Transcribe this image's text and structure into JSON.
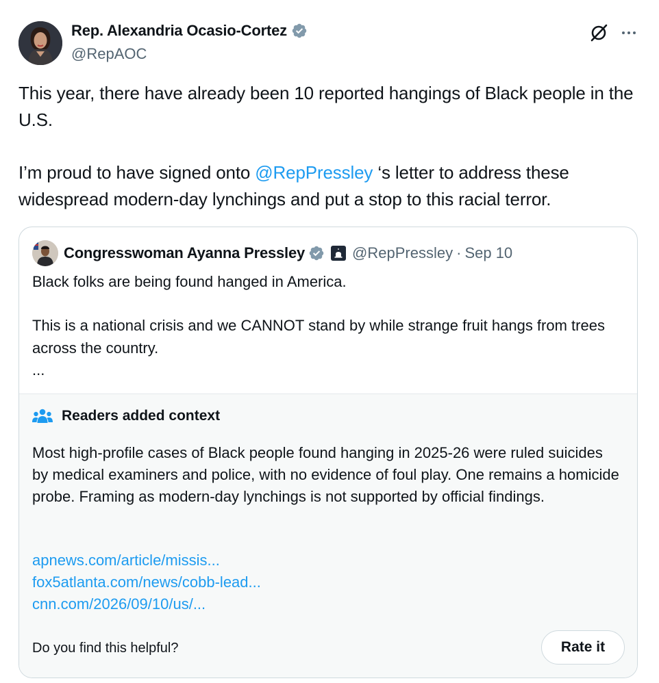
{
  "author": {
    "display_name": "Rep. Alexandria Ocasio-Cortez",
    "handle": "@RepAOC",
    "verified_icon": "verified-badge-gray"
  },
  "tweet": {
    "line1": "This year, there have already been 10 reported hangings of Black people in the U.S.",
    "line2_before": "I’m proud to have signed onto ",
    "line2_mention": "@RepPressley",
    "line2_after": " ‘s letter to address these widespread modern-day lynchings and put a stop to this racial terror."
  },
  "quote": {
    "display_name": "Congresswoman Ayanna Pressley",
    "handle": "@RepPressley",
    "separator": "·",
    "date": "Sep 10",
    "line1": "Black folks are being found hanged in America.",
    "line2": "This is a national crisis and we CANNOT stand by while strange fruit hangs from trees across the country.",
    "ellipsis": "..."
  },
  "note": {
    "heading": "Readers added context",
    "body": "Most high-profile cases of Black people found hanging in 2025-26 were ruled suicides by medical examiners and police, with no evidence of foul play. One remains a homicide probe. Framing as modern-day lynchings is not supported by official findings.",
    "links": [
      "apnews.com/article/missis...",
      "fox5atlanta.com/news/cobb-lead...",
      "cnn.com/2026/09/10/us/..."
    ],
    "helpful_prompt": "Do you find this helpful?",
    "rate_label": "Rate it"
  },
  "colors": {
    "link": "#1d9bf0",
    "secondary_text": "#536471",
    "note_background": "#f7f9f9"
  }
}
